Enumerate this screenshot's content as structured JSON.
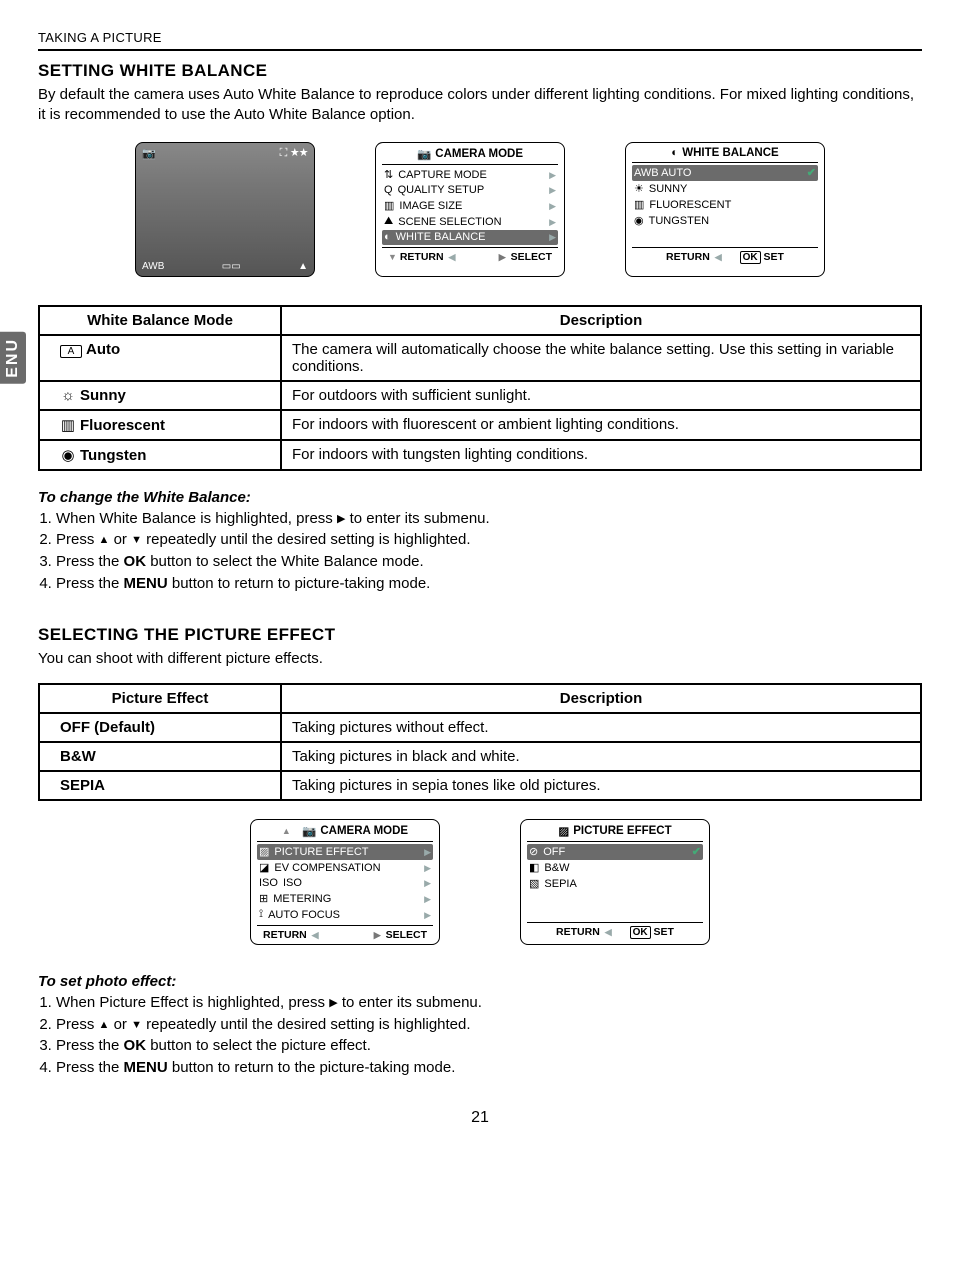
{
  "header": "TAKING A PICTURE",
  "side_tab": "ENU",
  "page_number": "21",
  "wb": {
    "title": "SETTING WHITE BALANCE",
    "intro": "By default the camera uses Auto White Balance to reproduce colors under different lighting conditions. For mixed lighting conditions, it is recommended to use the Auto White Balance option.",
    "screen_awb": "AWB",
    "menu1_title": "CAMERA MODE",
    "menu1_items": [
      "CAPTURE MODE",
      "QUALITY SETUP",
      "IMAGE SIZE",
      "SCENE SELECTION",
      "WHITE BALANCE"
    ],
    "menu1_foot_l": "RETURN",
    "menu1_foot_r": "SELECT",
    "menu2_title": "WHITE BALANCE",
    "menu2_items": [
      "AWB AUTO",
      "SUNNY",
      "FLUORESCENT",
      "TUNGSTEN"
    ],
    "menu2_foot_l": "RETURN",
    "menu2_foot_r": "SET",
    "tbl_head1": "White Balance Mode",
    "tbl_head2": "Description",
    "rows": [
      {
        "icon": "A",
        "name": "Auto",
        "desc": "The camera will automatically choose the white balance setting. Use this setting in variable conditions."
      },
      {
        "icon": "☼",
        "name": "Sunny",
        "desc": "For outdoors with sufficient sunlight."
      },
      {
        "icon": "▥",
        "name": "Fluorescent",
        "desc": "For indoors with fluorescent or ambient lighting conditions."
      },
      {
        "icon": "◉",
        "name": "Tungsten",
        "desc": "For indoors with tungsten lighting conditions."
      }
    ],
    "instr_title": "To change the White Balance:",
    "instr": [
      "When White Balance is highlighted, press ▶ to enter its submenu.",
      "Press ▲ or ▼ repeatedly until the desired setting is highlighted.",
      "Press the OK button to select the White Balance mode.",
      "Press the MENU button to return to picture-taking mode."
    ]
  },
  "pe": {
    "title": "SELECTING THE PICTURE EFFECT",
    "intro": "You can shoot with different picture effects.",
    "tbl_head1": "Picture Effect",
    "tbl_head2": "Description",
    "rows": [
      {
        "name": "OFF  (Default)",
        "desc": "Taking pictures without effect."
      },
      {
        "name": "B&W",
        "desc": "Taking pictures in black and white."
      },
      {
        "name": "SEPIA",
        "desc": "Taking pictures in sepia tones like old pictures."
      }
    ],
    "menu1_title": "CAMERA MODE",
    "menu1_items": [
      "PICTURE EFFECT",
      "EV COMPENSATION",
      "ISO",
      "METERING",
      "AUTO FOCUS"
    ],
    "menu1_foot_l": "RETURN",
    "menu1_foot_r": "SELECT",
    "menu2_title": "PICTURE EFFECT",
    "menu2_items": [
      "OFF",
      "B&W",
      "SEPIA"
    ],
    "menu2_foot_l": "RETURN",
    "menu2_foot_r": "SET",
    "instr_title": "To set photo effect:",
    "instr": [
      "When Picture Effect is highlighted, press ▶ to enter its submenu.",
      "Press ▲ or ▼ repeatedly until the desired setting is highlighted.",
      "Press the OK button to select the picture effect.",
      "Press the MENU button to return to the picture-taking mode."
    ]
  }
}
